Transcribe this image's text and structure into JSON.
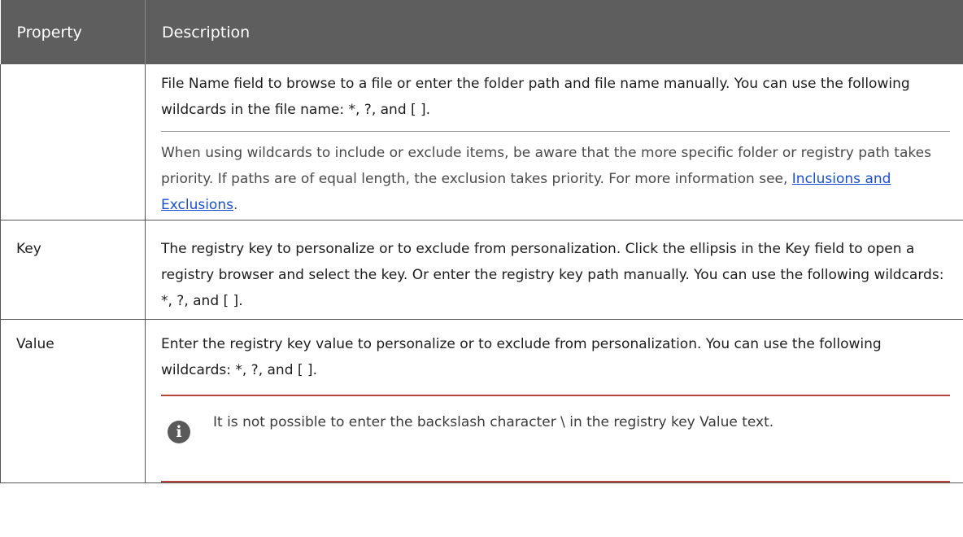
{
  "table": {
    "headers": {
      "property": "Property",
      "description": "Description"
    },
    "rows": [
      {
        "property": "",
        "description": "File Name field to browse to a file or enter the folder path and file name manually. You can use the following wildcards in the file name: *, ?, and [ ].",
        "note": "When using wildcards to include or exclude items, be aware that the more specific folder or registry path takes priority. If paths are of equal length, the exclusion takes priority. For more information see, ",
        "link_text": "Inclusions and Exclusions",
        "note_end": "."
      },
      {
        "property": "Key",
        "description": "The registry key to personalize or to exclude from personalization. Click the ellipsis in the Key field to open a registry browser and select the key. Or enter the registry key path manually. You can use the following wildcards: *, ?, and [ ]."
      },
      {
        "property": "Value",
        "description": "Enter the registry key value to personalize or to exclude from personalization. You can use the following wildcards: *, ?, and [ ].",
        "callout": "It is not possible to enter the backslash character \\ in the registry key Value text."
      }
    ]
  },
  "icons": {
    "callout_icon": "info-icon",
    "callout_glyph": "i"
  },
  "colors": {
    "header_bg": "#5e5e5e",
    "link": "#1a4fd0",
    "callout_rule": "#b5453e"
  }
}
